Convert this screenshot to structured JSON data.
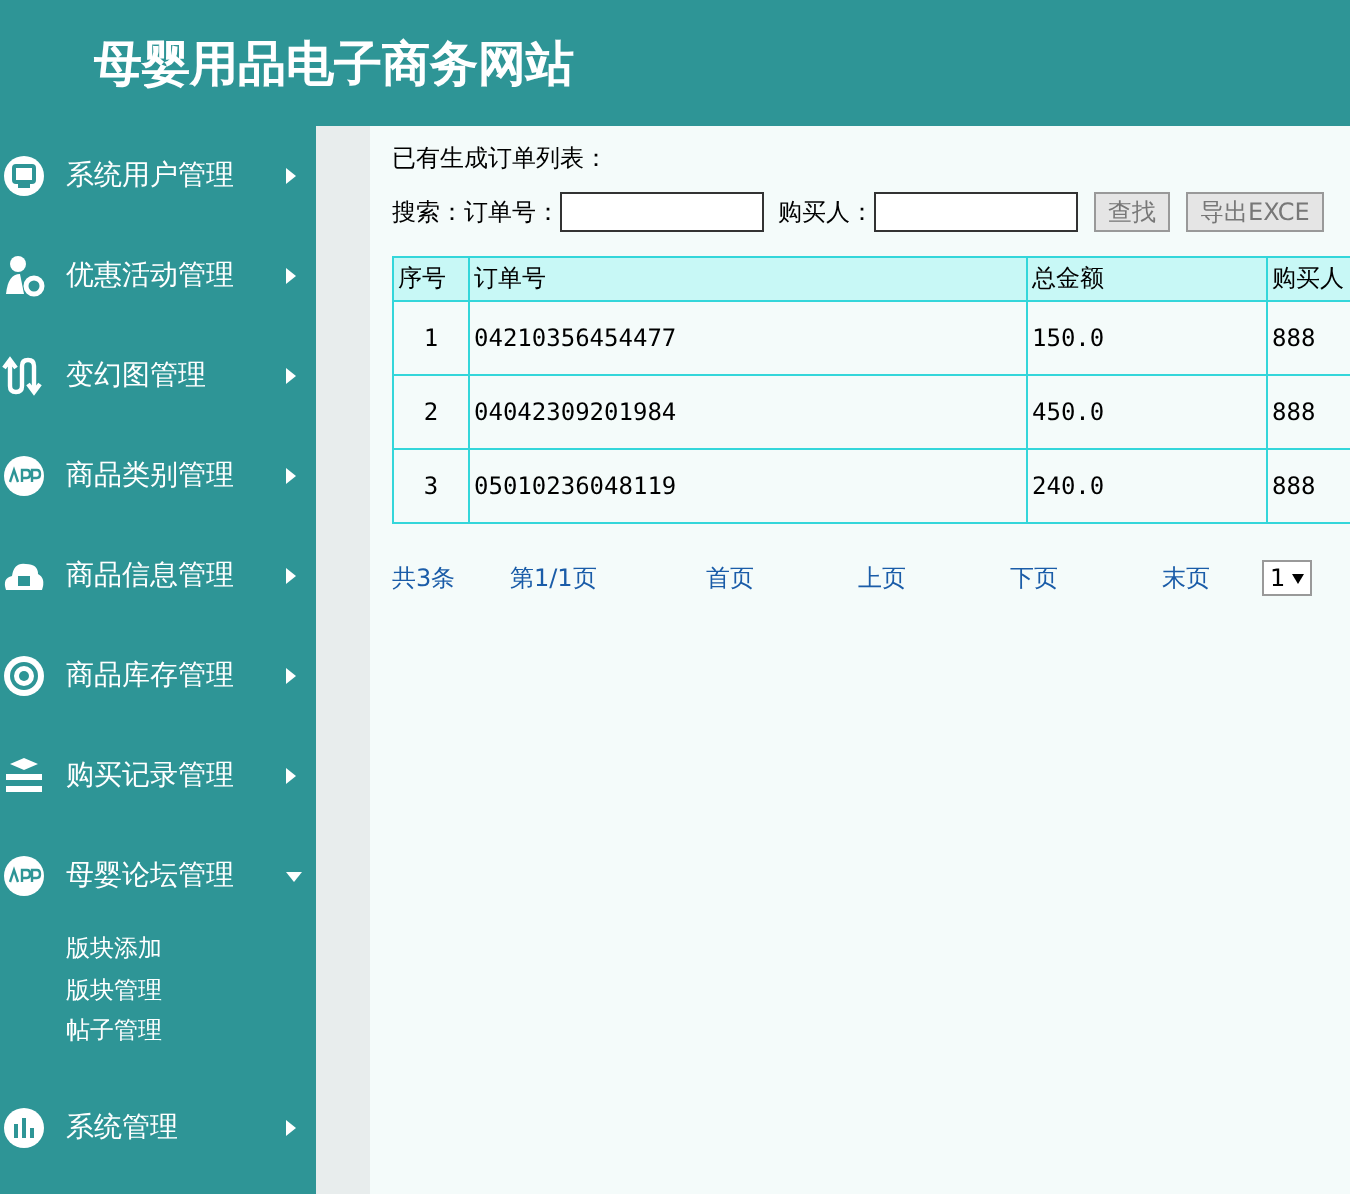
{
  "header": {
    "title": "母婴用品电子商务网站"
  },
  "sidebar": {
    "items": [
      {
        "label": "系统用户管理",
        "expanded": false
      },
      {
        "label": "优惠活动管理",
        "expanded": false
      },
      {
        "label": "变幻图管理",
        "expanded": false
      },
      {
        "label": "商品类别管理",
        "expanded": false
      },
      {
        "label": "商品信息管理",
        "expanded": false
      },
      {
        "label": "商品库存管理",
        "expanded": false
      },
      {
        "label": "购买记录管理",
        "expanded": false
      },
      {
        "label": "母婴论坛管理",
        "expanded": true,
        "children": [
          {
            "label": "版块添加"
          },
          {
            "label": "版块管理"
          },
          {
            "label": "帖子管理"
          }
        ]
      },
      {
        "label": "系统管理",
        "expanded": false
      }
    ]
  },
  "content": {
    "heading": "已有生成订单列表：",
    "search": {
      "label": "搜索：",
      "fields": [
        {
          "label": "订单号："
        },
        {
          "label": "购买人："
        }
      ],
      "buttons": [
        "查找",
        "导出EXCE"
      ]
    },
    "table": {
      "columns": [
        "序号",
        "订单号",
        "总金额",
        "购买人"
      ],
      "rows": [
        [
          "1",
          "04210356454477",
          "150.0",
          "888"
        ],
        [
          "2",
          "04042309201984",
          "450.0",
          "888"
        ],
        [
          "3",
          "05010236048119",
          "240.0",
          "888"
        ]
      ]
    },
    "pagination": {
      "total": "共3条",
      "page": "第1/1页",
      "links": [
        "首页",
        "上页",
        "下页",
        "末页"
      ],
      "select": "1"
    }
  }
}
